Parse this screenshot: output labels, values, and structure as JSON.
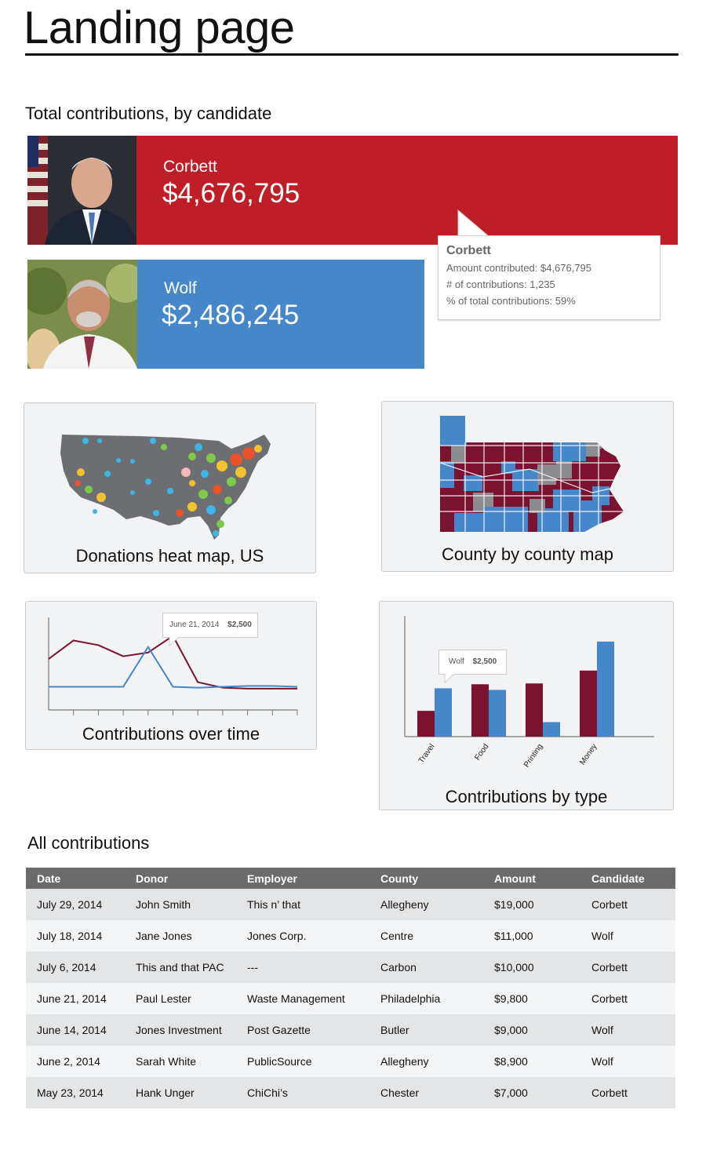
{
  "page": {
    "title": "Landing page"
  },
  "totals": {
    "section_title": "Total contributions, by candidate",
    "candidates": [
      {
        "name": "Corbett",
        "amount": "$4,676,795",
        "color": "#bd1e27",
        "share": 1.0
      },
      {
        "name": "Wolf",
        "amount": "$2,486,245",
        "color": "#4587c9",
        "share": 0.53
      }
    ],
    "tooltip": {
      "title": "Corbett",
      "lines": [
        "Amount contributed: $4,676,795",
        "# of contributions: 1,235",
        "% of total contributions: 59%"
      ]
    }
  },
  "cards": {
    "heat_map": {
      "label": "Donations heat map, US"
    },
    "county_map": {
      "label": "County by county map"
    },
    "over_time": {
      "label": "Contributions over time",
      "tooltip_date": "June 21, 2014",
      "tooltip_amount": "$2,500"
    },
    "by_type": {
      "label": "Contributions by type",
      "tooltip_name": "Wolf",
      "tooltip_amount": "$2,500"
    }
  },
  "chart_data": [
    {
      "type": "line",
      "title": "Contributions over time",
      "x": [
        0,
        1,
        2,
        3,
        4,
        5,
        6,
        7,
        8,
        9,
        10
      ],
      "series": [
        {
          "color": "#7a1230",
          "values": [
            55,
            75,
            70,
            58,
            62,
            80,
            30,
            24,
            23,
            23,
            23
          ]
        },
        {
          "color": "#4587c9",
          "values": [
            25,
            25,
            25,
            25,
            68,
            25,
            24,
            25,
            26,
            26,
            25
          ]
        }
      ],
      "ylim": [
        0,
        100
      ],
      "grid": false
    },
    {
      "type": "bar",
      "title": "Contributions by type",
      "categories": [
        "Travel",
        "Food",
        "Printing",
        "Money"
      ],
      "series": [
        {
          "color": "#7a1230",
          "values": [
            32,
            65,
            66,
            82
          ]
        },
        {
          "color": "#4587c9",
          "values": [
            60,
            58,
            18,
            118
          ]
        }
      ],
      "ylim": [
        0,
        150
      ],
      "grid": false
    }
  ],
  "table": {
    "section_title": "All contributions",
    "columns": [
      "Date",
      "Donor",
      "Employer",
      "County",
      "Amount",
      "Candidate"
    ],
    "rows": [
      [
        "July 29, 2014",
        "John Smith",
        "This n’ that",
        "Allegheny",
        "$19,000",
        "Corbett"
      ],
      [
        "July 18, 2014",
        "Jane Jones",
        "Jones Corp.",
        "Centre",
        "$11,000",
        "Wolf"
      ],
      [
        "July 6, 2014",
        "This and that PAC",
        "---",
        "Carbon",
        "$10,000",
        "Corbett"
      ],
      [
        "June 21, 2014",
        "Paul Lester",
        "Waste Management",
        "Philadelphia",
        "$9,800",
        "Corbett"
      ],
      [
        "June 14, 2014",
        "Jones Investment",
        "Post Gazette",
        "Butler",
        "$9,000",
        "Wolf"
      ],
      [
        "June 2, 2014",
        "Sarah White",
        "PublicSource",
        "Allegheny",
        "$8,900",
        "Wolf"
      ],
      [
        "May 23, 2014",
        "Hank Unger",
        "ChiChi’s",
        "Chester",
        "$7,000",
        "Corbett"
      ]
    ]
  }
}
